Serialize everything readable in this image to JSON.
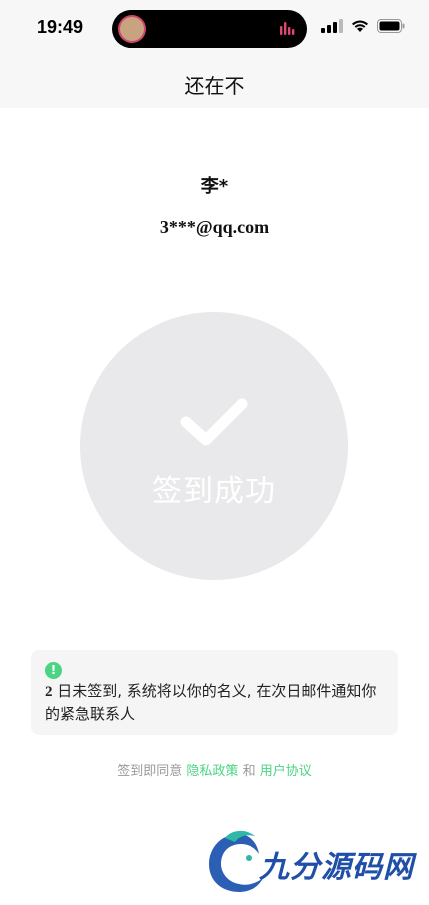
{
  "status_bar": {
    "time": "19:49",
    "icons": [
      "cellular-signal-icon",
      "wifi-icon",
      "battery-icon"
    ]
  },
  "nav": {
    "title": "还在不"
  },
  "user": {
    "name": "李*",
    "email": "3***@qq.com"
  },
  "checkin": {
    "label": "签到成功",
    "icon": "checkmark-icon",
    "circle_color": "#e9e9eb"
  },
  "notice": {
    "icon": "!",
    "days": "2",
    "text": " 日未签到, 系统将以你的名义, 在次日邮件通知你的紧急联系人"
  },
  "agreement": {
    "prefix": "签到即同意",
    "privacy_link": "隐私政策",
    "and": "和",
    "terms_link": "用户协议",
    "link_color": "#4cd484"
  },
  "watermark": {
    "text": "九分源码网"
  }
}
